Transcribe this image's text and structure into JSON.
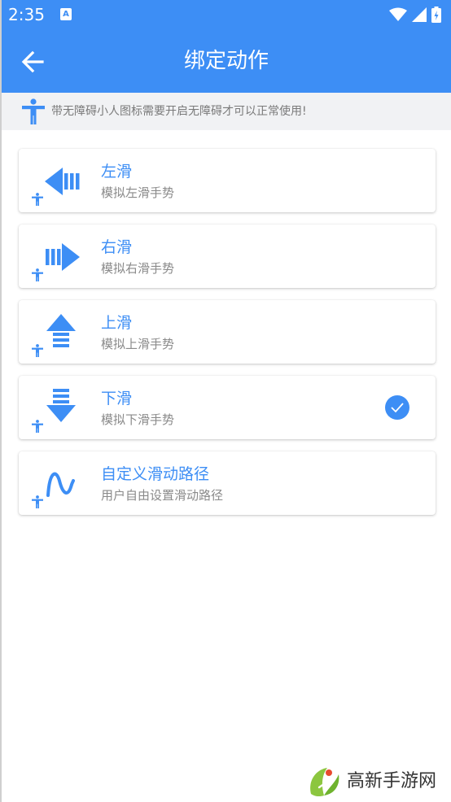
{
  "status_bar": {
    "time": "2:35",
    "notification_letter": "A",
    "icons": [
      "wifi-icon",
      "signal-icon",
      "battery-icon"
    ]
  },
  "app_bar": {
    "title": "绑定动作",
    "back_icon": "back-arrow-icon"
  },
  "notice": {
    "icon": "accessibility-icon",
    "text": "带无障碍小人图标需要开启无障碍才可以正常使用!"
  },
  "actions": [
    {
      "icon": "swipe-left-icon",
      "title": "左滑",
      "subtitle": "模拟左滑手势",
      "selected": false
    },
    {
      "icon": "swipe-right-icon",
      "title": "右滑",
      "subtitle": "模拟右滑手势",
      "selected": false
    },
    {
      "icon": "swipe-up-icon",
      "title": "上滑",
      "subtitle": "模拟上滑手势",
      "selected": false
    },
    {
      "icon": "swipe-down-icon",
      "title": "下滑",
      "subtitle": "模拟下滑手势",
      "selected": true
    },
    {
      "icon": "custom-path-icon",
      "title": "自定义滑动路径",
      "subtitle": "用户自由设置滑动路径",
      "selected": false
    }
  ],
  "watermark": {
    "text": "高新手游网"
  },
  "colors": {
    "primary": "#3d8ef5",
    "notice_bg": "#f1f2f4",
    "subtitle": "#8a8a8a"
  }
}
